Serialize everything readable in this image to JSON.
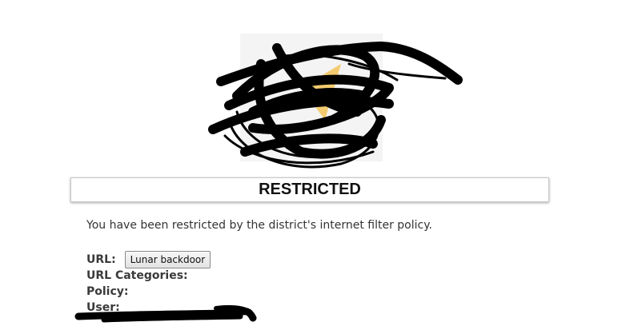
{
  "logo": {
    "redacted": true
  },
  "page": {
    "title": "RESTRICTED",
    "message": "You have been restricted by the district's internet filter policy."
  },
  "details": {
    "url_label": "URL:",
    "url_button_label": "Lunar backdoor",
    "categories_label": "URL Categories:",
    "policy_label": "Policy:",
    "user_label": "User:"
  },
  "colors": {
    "scribble": "#000000",
    "logo_accent": "#f2c14e"
  }
}
